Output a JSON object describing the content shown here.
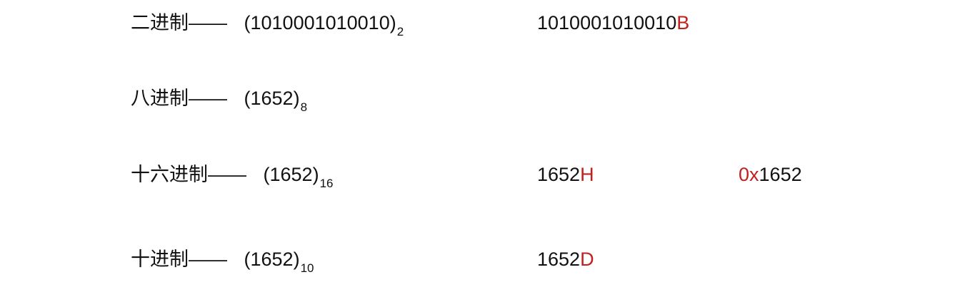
{
  "rows": [
    {
      "label": "二进制——",
      "notation": "(1010001010010)",
      "base_sub": "2",
      "alt1_value": "1010001010010",
      "alt1_suffix": "B"
    },
    {
      "label": "八进制——",
      "notation": "(1652)",
      "base_sub": "8"
    },
    {
      "label": "十六进制——",
      "notation": "(1652)",
      "base_sub": "16",
      "alt1_value": "1652",
      "alt1_suffix": "H",
      "alt2_prefix": "0x",
      "alt2_value": "1652"
    },
    {
      "label": "十进制——",
      "notation": "(1652)",
      "base_sub": "10",
      "alt1_value": "1652",
      "alt1_suffix": "D"
    }
  ],
  "colors": {
    "text": "#111111",
    "accent": "#c21f1f"
  }
}
